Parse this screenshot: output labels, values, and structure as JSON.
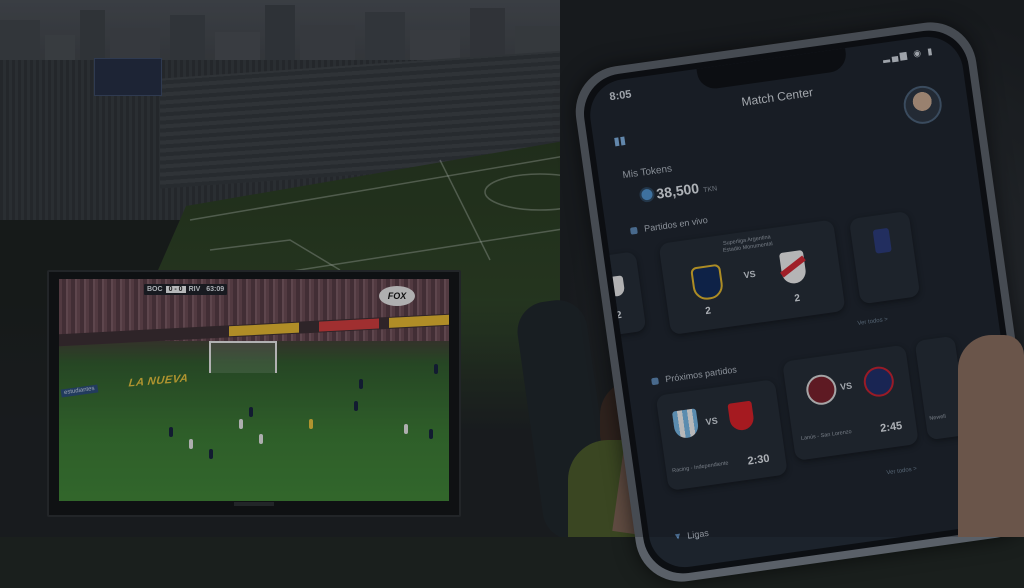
{
  "tv": {
    "score_bug": {
      "home": "BOC",
      "score": "0 - 0",
      "away": "RIV",
      "clock": "63:09"
    },
    "channel_logo": "FOX",
    "ad_board_text": "LA NUEVA",
    "sponsor_text": "estudiantes"
  },
  "phone": {
    "status": {
      "time": "8:05",
      "icons": "▂▄▆ ◉ ▮"
    },
    "app_title": "Match Center",
    "tokens": {
      "label": "Mis Tokens",
      "value": "38,500",
      "unit": "TKN"
    },
    "live_section": {
      "title": "Partidos en vivo",
      "featured": {
        "competition": "Superliga Argentina",
        "venue": "Estadio Monumental",
        "home": "CABJ",
        "away": "River Plate",
        "home_score": "2",
        "away_score": "2",
        "vs": "VS"
      },
      "left_partial": {
        "score": "2"
      },
      "more_label": "Ver todos >"
    },
    "upcoming_section": {
      "title": "Próximos partidos",
      "matches": [
        {
          "home": "Racing",
          "away": "Independiente",
          "label": "Racing - Independiente",
          "time": "2:30",
          "vs": "VS"
        },
        {
          "home": "Lanús",
          "away": "San Lorenzo",
          "label": "Lanús - San Lorenzo",
          "time": "2:45",
          "vs": "VS"
        }
      ],
      "more_label": "Ver todos >",
      "right_partial": "Newell"
    },
    "ligas_label": "Ligas"
  }
}
